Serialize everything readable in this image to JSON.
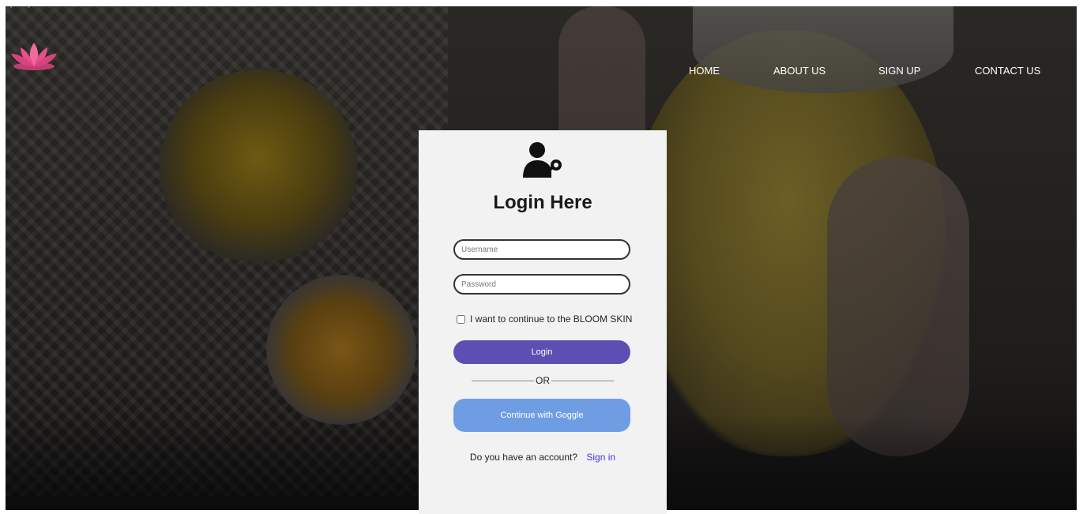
{
  "browser": {
    "back_glyph": "‹",
    "forward_glyph": "›"
  },
  "brand": {
    "logo_icon": "lotus-icon",
    "logo_color": "#e94d8c"
  },
  "nav": {
    "items": [
      {
        "label": "HOME"
      },
      {
        "label": "ABOUT US"
      },
      {
        "label": "SIGN UP"
      },
      {
        "label": "CONTACT US"
      }
    ]
  },
  "login": {
    "icon": "user-key-icon",
    "title": "Login Here",
    "username_placeholder": "Username",
    "password_placeholder": "Password",
    "checkbox_label": "I want to continue to the BLOOM SKIN",
    "login_button": "Login",
    "divider_text": "OR",
    "google_button": "Continue with Goggle",
    "account_question": "Do you have an account?",
    "sign_in_link": "Sign in"
  },
  "colors": {
    "login_button": "#5b4fb3",
    "google_button": "#6f9de3",
    "link": "#3b3bd8",
    "card_bg": "#f2f2f2"
  }
}
